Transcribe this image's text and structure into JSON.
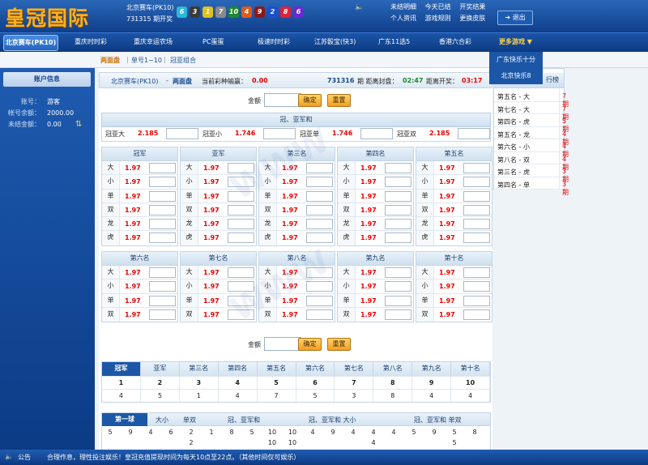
{
  "header": {
    "logo": "皇冠国际",
    "lottery_name": "北京赛车(PK10)",
    "period_line": "731315 期开奖",
    "balls": [
      {
        "num": "6",
        "color": "#2db7d6"
      },
      {
        "num": "3",
        "color": "#3a3a3a"
      },
      {
        "num": "1",
        "color": "#e0c020"
      },
      {
        "num": "7",
        "color": "#8a8a8a"
      },
      {
        "num": "10",
        "color": "#1d8a2a"
      },
      {
        "num": "4",
        "color": "#e05a1a"
      },
      {
        "num": "9",
        "color": "#8a1a1a"
      },
      {
        "num": "2",
        "color": "#1a4fd0"
      },
      {
        "num": "8",
        "color": "#e0203a"
      },
      {
        "num": "6",
        "color": "#6a2ad0"
      }
    ],
    "links": [
      "未结明细",
      "今天已结",
      "开奖结果",
      "个人资讯",
      "游戏规则",
      "更换皮肤"
    ],
    "logout": "退出"
  },
  "nav": {
    "active": "北京赛车(PK10)",
    "items": [
      "重庆时时彩",
      "重庆幸运农场",
      "PC蛋蛋",
      "极速时时彩",
      "江苏骰宝(快3)",
      "广东11选5",
      "香港六合彩"
    ],
    "more": "更多游戏 ▼"
  },
  "dropdown": [
    "广东快乐十分",
    "北京快乐8"
  ],
  "subnav": [
    "两面盘",
    "单号1~10",
    "冠亚组合"
  ],
  "sidebar": {
    "title": "账户信息",
    "rows": [
      {
        "label": "账号：",
        "value": "游客"
      },
      {
        "label": "帐号余额：",
        "value": "2000.00"
      },
      {
        "label": "未结金额：",
        "value": "0.00"
      }
    ]
  },
  "infobar": {
    "lottery": "北京赛车(PK10)",
    "dash": "-",
    "mode": "两面盘",
    "win_label": "当前彩种输赢：",
    "win_value": "0.00",
    "period": "731316",
    "close_label": "期  距离封盘：",
    "close_time": "02:47",
    "open_label": "距离开奖：",
    "open_time": "03:17"
  },
  "bet": {
    "amount_label": "金额",
    "confirm": "确定",
    "reset": "重置"
  },
  "gy": {
    "title": "冠、亚军和",
    "cells": [
      {
        "name": "冠亚大",
        "odds": "2.185"
      },
      {
        "name": "冠亚小",
        "odds": "1.746"
      },
      {
        "name": "冠亚单",
        "odds": "1.746"
      },
      {
        "name": "冠亚双",
        "odds": "2.185"
      }
    ]
  },
  "grids_top": [
    {
      "title": "冠军",
      "rows": [
        [
          "大",
          "1.97"
        ],
        [
          "小",
          "1.97"
        ],
        [
          "单",
          "1.97"
        ],
        [
          "双",
          "1.97"
        ],
        [
          "龙",
          "1.97"
        ],
        [
          "虎",
          "1.97"
        ]
      ]
    },
    {
      "title": "亚军",
      "rows": [
        [
          "大",
          "1.97"
        ],
        [
          "小",
          "1.97"
        ],
        [
          "单",
          "1.97"
        ],
        [
          "双",
          "1.97"
        ],
        [
          "龙",
          "1.97"
        ],
        [
          "虎",
          "1.97"
        ]
      ]
    },
    {
      "title": "第三名",
      "rows": [
        [
          "大",
          "1.97"
        ],
        [
          "小",
          "1.97"
        ],
        [
          "单",
          "1.97"
        ],
        [
          "双",
          "1.97"
        ],
        [
          "龙",
          "1.97"
        ],
        [
          "虎",
          "1.97"
        ]
      ]
    },
    {
      "title": "第四名",
      "rows": [
        [
          "大",
          "1.97"
        ],
        [
          "小",
          "1.97"
        ],
        [
          "单",
          "1.97"
        ],
        [
          "双",
          "1.97"
        ],
        [
          "龙",
          "1.97"
        ],
        [
          "虎",
          "1.97"
        ]
      ]
    },
    {
      "title": "第五名",
      "rows": [
        [
          "大",
          "1.97"
        ],
        [
          "小",
          "1.97"
        ],
        [
          "单",
          "1.97"
        ],
        [
          "双",
          "1.97"
        ],
        [
          "龙",
          "1.97"
        ],
        [
          "虎",
          "1.97"
        ]
      ]
    }
  ],
  "grids_bottom": [
    {
      "title": "第六名",
      "rows": [
        [
          "大",
          "1.97"
        ],
        [
          "小",
          "1.97"
        ],
        [
          "单",
          "1.97"
        ],
        [
          "双",
          "1.97"
        ]
      ]
    },
    {
      "title": "第七名",
      "rows": [
        [
          "大",
          "1.97"
        ],
        [
          "小",
          "1.97"
        ],
        [
          "单",
          "1.97"
        ],
        [
          "双",
          "1.97"
        ]
      ]
    },
    {
      "title": "第八名",
      "rows": [
        [
          "大",
          "1.97"
        ],
        [
          "小",
          "1.97"
        ],
        [
          "单",
          "1.97"
        ],
        [
          "双",
          "1.97"
        ]
      ]
    },
    {
      "title": "第九名",
      "rows": [
        [
          "大",
          "1.97"
        ],
        [
          "小",
          "1.97"
        ],
        [
          "单",
          "1.97"
        ],
        [
          "双",
          "1.97"
        ]
      ]
    },
    {
      "title": "第十名",
      "rows": [
        [
          "大",
          "1.97"
        ],
        [
          "小",
          "1.97"
        ],
        [
          "单",
          "1.97"
        ],
        [
          "双",
          "1.97"
        ]
      ]
    }
  ],
  "results": {
    "headers": [
      "冠军",
      "亚军",
      "第三名",
      "第四名",
      "第五名",
      "第六名",
      "第七名",
      "第八名",
      "第九名",
      "第十名"
    ],
    "row1": [
      "1",
      "2",
      "3",
      "4",
      "5",
      "6",
      "7",
      "8",
      "9",
      "10"
    ],
    "row2": [
      "4",
      "5",
      "1",
      "4",
      "7",
      "5",
      "3",
      "8",
      "4",
      "4"
    ]
  },
  "bottom_tabs": {
    "active": "第一球",
    "items": [
      "大小",
      "单双",
      "冠、亚军和",
      "冠、亚军和 大小",
      "冠、亚军和 单双"
    ]
  },
  "bottom_numbers": [
    [
      "5",
      "9",
      "4",
      "6",
      "2",
      "1",
      "8",
      "5",
      "10",
      "10",
      "4",
      "9",
      "4",
      "4",
      "4",
      "5",
      "9",
      "5",
      "8"
    ],
    [
      "",
      "",
      "",
      "",
      "2",
      "",
      "",
      "",
      "10",
      "10",
      "",
      "",
      "",
      "4",
      "",
      "",
      "",
      "5",
      ""
    ]
  ],
  "rank": {
    "title": "行榜",
    "rows": [
      {
        "name": "第五名 - 大",
        "period": "7期"
      },
      {
        "name": "第七名 - 大",
        "period": "7期"
      },
      {
        "name": "第四名 - 虎",
        "period": "5期"
      },
      {
        "name": "第五名 - 龙",
        "period": "4期"
      },
      {
        "name": "第六名 - 小",
        "period": "4期"
      },
      {
        "name": "第八名 - 双",
        "period": "4期"
      },
      {
        "name": "第三名 - 虎",
        "period": "3期"
      },
      {
        "name": "第四名 - 单",
        "period": "3期"
      }
    ]
  },
  "footer": {
    "label": "公告",
    "text": "合理作息，理性投注娱乐！皇冠充值提现时间为每天10点至22点。（其他时间仅可娱乐）"
  }
}
